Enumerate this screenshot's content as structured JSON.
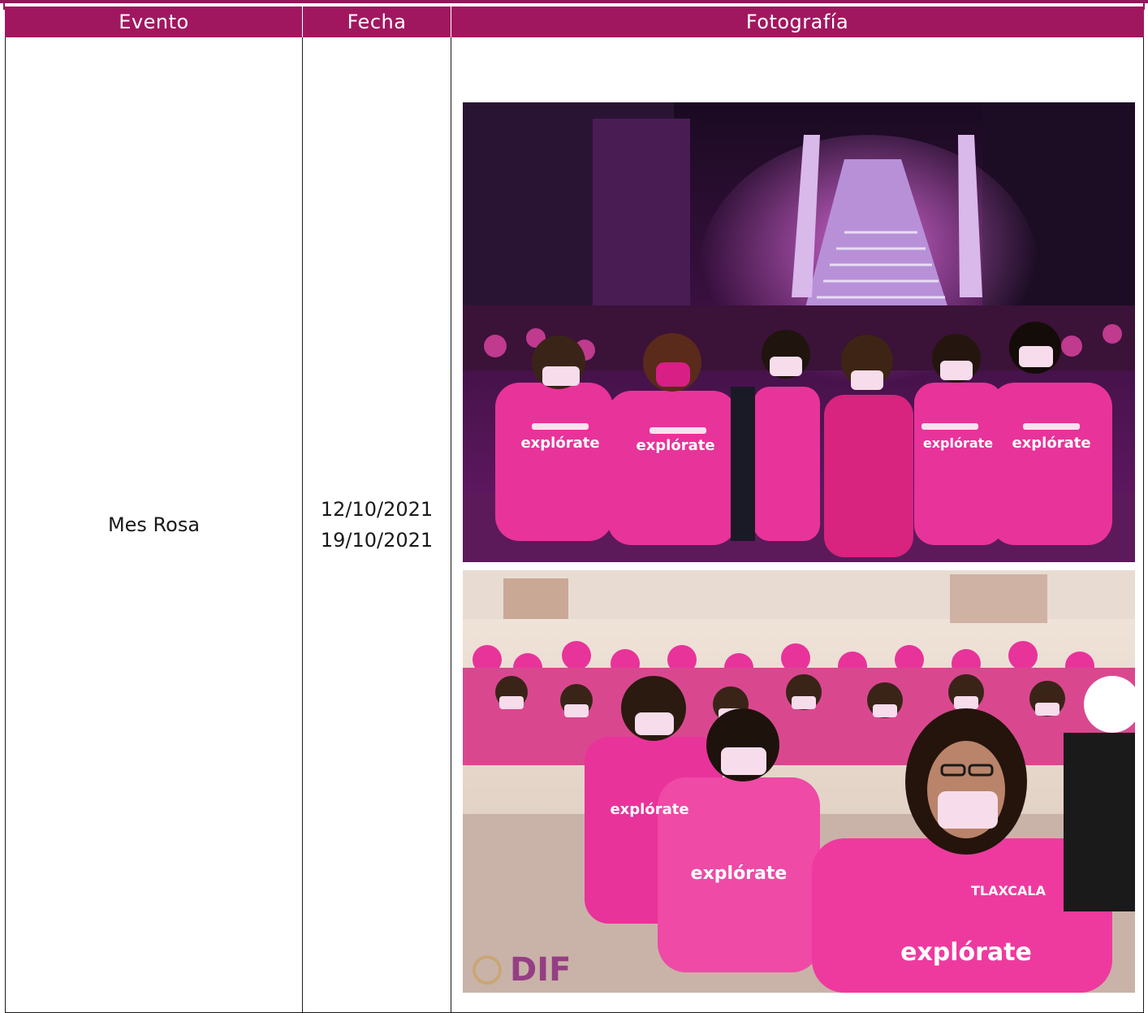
{
  "table": {
    "headers": {
      "event": "Evento",
      "date": "Fecha",
      "photo": "Fotografía"
    },
    "rows": [
      {
        "event": "Mes Rosa",
        "dates": [
          "12/10/2021",
          "19/10/2021"
        ],
        "photos": [
          {
            "shirt_text": "explórate"
          },
          {
            "shirt_text": "explórate",
            "logo_text": "DIF",
            "shirt_brand": "TLAXCALA"
          }
        ]
      }
    ]
  },
  "colors": {
    "header_bg": "#a1175f",
    "header_text": "#ffffff",
    "border": "#1a1a1a",
    "shirt_pink": "#e8339a"
  }
}
